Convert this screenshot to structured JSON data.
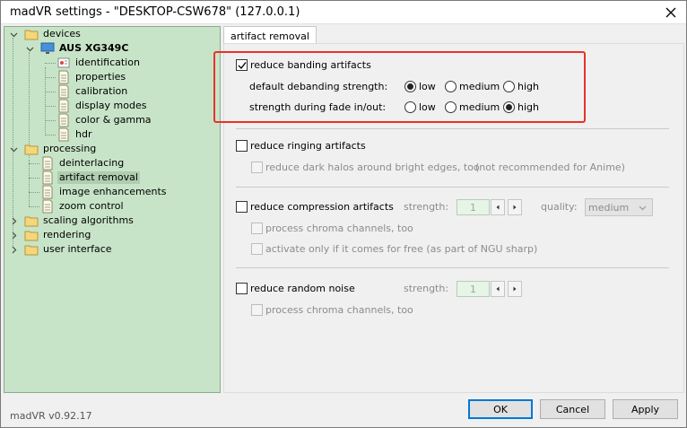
{
  "window": {
    "title": "madVR settings - \"DESKTOP-CSW678\" (127.0.0.1)"
  },
  "tree": {
    "devices": "devices",
    "device_name": "AUS XG349C",
    "device_items": [
      "identification",
      "properties",
      "calibration",
      "display modes",
      "color & gamma",
      "hdr"
    ],
    "processing": "processing",
    "processing_items": [
      "deinterlacing",
      "artifact removal",
      "image enhancements",
      "zoom control"
    ],
    "scaling": "scaling algorithms",
    "rendering": "rendering",
    "user_interface": "user interface"
  },
  "tab": {
    "label": "artifact removal"
  },
  "banding": {
    "label": "reduce banding artifacts",
    "checked": true,
    "default_label": "default debanding strength:",
    "fade_label": "strength during fade in/out:",
    "options": [
      "low",
      "medium",
      "high"
    ],
    "default_selected": "low",
    "fade_selected": "high"
  },
  "ringing": {
    "label": "reduce ringing artifacts",
    "halos_label": "reduce dark halos around bright edges, too",
    "halos_note": "(not recommended for Anime)"
  },
  "compression": {
    "label": "reduce compression artifacts",
    "strength_label": "strength:",
    "strength_value": "1",
    "quality_label": "quality:",
    "quality_value": "medium",
    "chroma_label": "process chroma channels, too",
    "free_label": "activate only if it comes for free (as part of NGU sharp)"
  },
  "noise": {
    "label": "reduce random noise",
    "strength_label": "strength:",
    "strength_value": "1",
    "chroma_label": "process chroma channels, too"
  },
  "footer": {
    "version": "madVR v0.92.17",
    "ok": "OK",
    "cancel": "Cancel",
    "apply": "Apply"
  }
}
